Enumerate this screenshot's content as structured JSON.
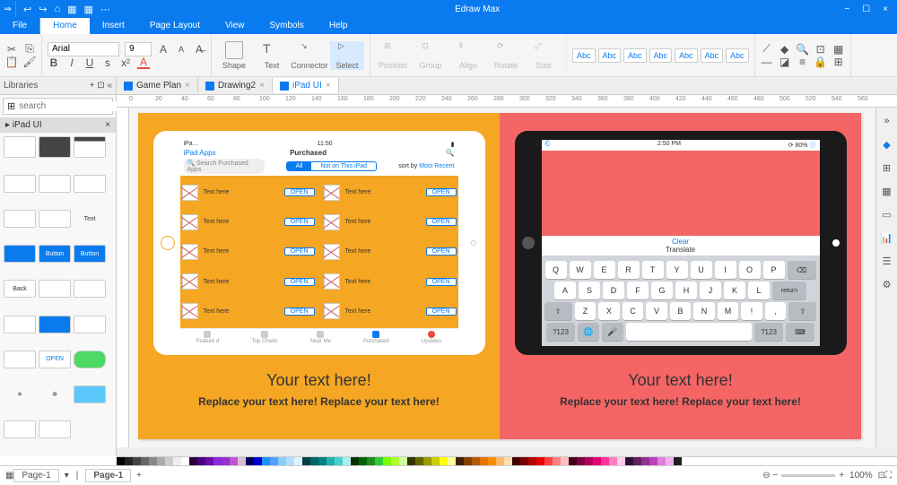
{
  "app": {
    "title": "Edraw Max"
  },
  "window_buttons": {
    "min": "−",
    "max": "☐",
    "close": "×"
  },
  "qat": [
    "↩",
    "↪",
    "⌂",
    "▦",
    "▦",
    "⋯"
  ],
  "menu": {
    "file": "File",
    "tabs": [
      "Home",
      "Insert",
      "Page Layout",
      "View",
      "Symbols",
      "Help"
    ],
    "active": "Home"
  },
  "ribbon": {
    "clipboard": {
      "cut": "✂",
      "copy": "⎘",
      "paste": "📋",
      "brush": "🖌"
    },
    "font": {
      "name": "Arial",
      "size": "9",
      "incr": "A",
      "decr": "A",
      "clear": "A̶",
      "bold": "B",
      "italic": "I",
      "underline": "U",
      "strike": "ꜱ",
      "sup": "x²",
      "color": "A"
    },
    "tools": {
      "shape": "Shape",
      "text": "Text",
      "connector": "Connector",
      "select": "Select"
    },
    "arrange": {
      "position": "Position",
      "group": "Group",
      "align": "Align",
      "rotate": "Rotate",
      "size": "Size"
    },
    "styles": [
      "Abc",
      "Abc",
      "Abc",
      "Abc",
      "Abc",
      "Abc",
      "Abc"
    ],
    "right_icons": [
      "⤢",
      "⊞",
      "⊡"
    ]
  },
  "left_panel": {
    "header": "Libraries",
    "search_placeholder": "search",
    "lib_name": "iPad UI",
    "items_text": [
      "Text",
      "Button",
      "Button",
      "Back",
      "OPEN"
    ]
  },
  "doc_tabs": [
    {
      "label": "Game Plan",
      "active": false
    },
    {
      "label": "Drawing2",
      "active": false
    },
    {
      "label": "iPad UI",
      "active": true
    }
  ],
  "ruler_marks": [
    "0",
    "20",
    "40",
    "60",
    "80",
    "100",
    "120",
    "140",
    "160",
    "180",
    "200",
    "220",
    "240",
    "260",
    "280",
    "300",
    "320",
    "340",
    "360",
    "380",
    "400",
    "420",
    "440",
    "460",
    "480",
    "500",
    "520",
    "540",
    "560"
  ],
  "ipad_store": {
    "carrier": "iPa…",
    "time": "11:50",
    "back": "iPad Apps",
    "title": "Purchased",
    "search_icon": "🔍",
    "seg_search": "Search Purchased Apps",
    "seg": [
      "All",
      "Not on This iPad"
    ],
    "seg_active": 0,
    "sortby": "sort by",
    "sortval": "Most Recent",
    "app_label": "Text here",
    "open": "OPEN",
    "tabs": [
      "Feature d",
      "Top Charts",
      "Near Me",
      "Purchased",
      "Updates"
    ],
    "tab_active": 3
  },
  "ipad_kb": {
    "time": "2:50  PM",
    "battery": "80%",
    "actions": [
      "Clear",
      "Translate"
    ],
    "rows": [
      [
        "Q",
        "W",
        "E",
        "R",
        "T",
        "Y",
        "U",
        "I",
        "O",
        "P"
      ],
      [
        "A",
        "S",
        "D",
        "F",
        "G",
        "H",
        "J",
        "K",
        "L"
      ],
      [
        "Z",
        "X",
        "C",
        "V",
        "B",
        "N",
        "M",
        "!",
        ","
      ],
      []
    ],
    "return": "return",
    "shift": "⇧",
    "n123": "?123",
    "globe": "🌐",
    "mic": "🎤"
  },
  "captions": {
    "headline": "Your text here!",
    "sub": "Replace your text here!  Replace your text here!"
  },
  "status": {
    "page_sel": "Page-1",
    "page_tab": "Page-1",
    "zoom": "100%"
  },
  "palette_colors": [
    "#000",
    "#222",
    "#444",
    "#666",
    "#888",
    "#aaa",
    "#ccc",
    "#eee",
    "#fff",
    "#2c003e",
    "#4b0082",
    "#6a0dad",
    "#8a2be2",
    "#9932cc",
    "#ba55d3",
    "#d8bfd8",
    "#00005a",
    "#0000cd",
    "#1e90ff",
    "#4fa3ff",
    "#87cefa",
    "#b0e0ff",
    "#dff3ff",
    "#004040",
    "#006666",
    "#008080",
    "#20b2aa",
    "#48d1cc",
    "#afeeee",
    "#003300",
    "#006400",
    "#228b22",
    "#32cd32",
    "#7cfc00",
    "#adff2f",
    "#ccff99",
    "#333300",
    "#666600",
    "#999900",
    "#cccc00",
    "#ffff00",
    "#ffff99",
    "#402000",
    "#804000",
    "#b35900",
    "#e67300",
    "#ff8c00",
    "#ffb766",
    "#ffe0b3",
    "#400000",
    "#800000",
    "#b30000",
    "#e60000",
    "#ff4040",
    "#ff8080",
    "#ffc0c0",
    "#400020",
    "#800040",
    "#b30059",
    "#e60073",
    "#ff3399",
    "#ff80bf",
    "#ffcce6",
    "#301030",
    "#602060",
    "#903090",
    "#c040c0",
    "#e080e0",
    "#f0b0f0",
    "#202020",
    "#fff"
  ]
}
